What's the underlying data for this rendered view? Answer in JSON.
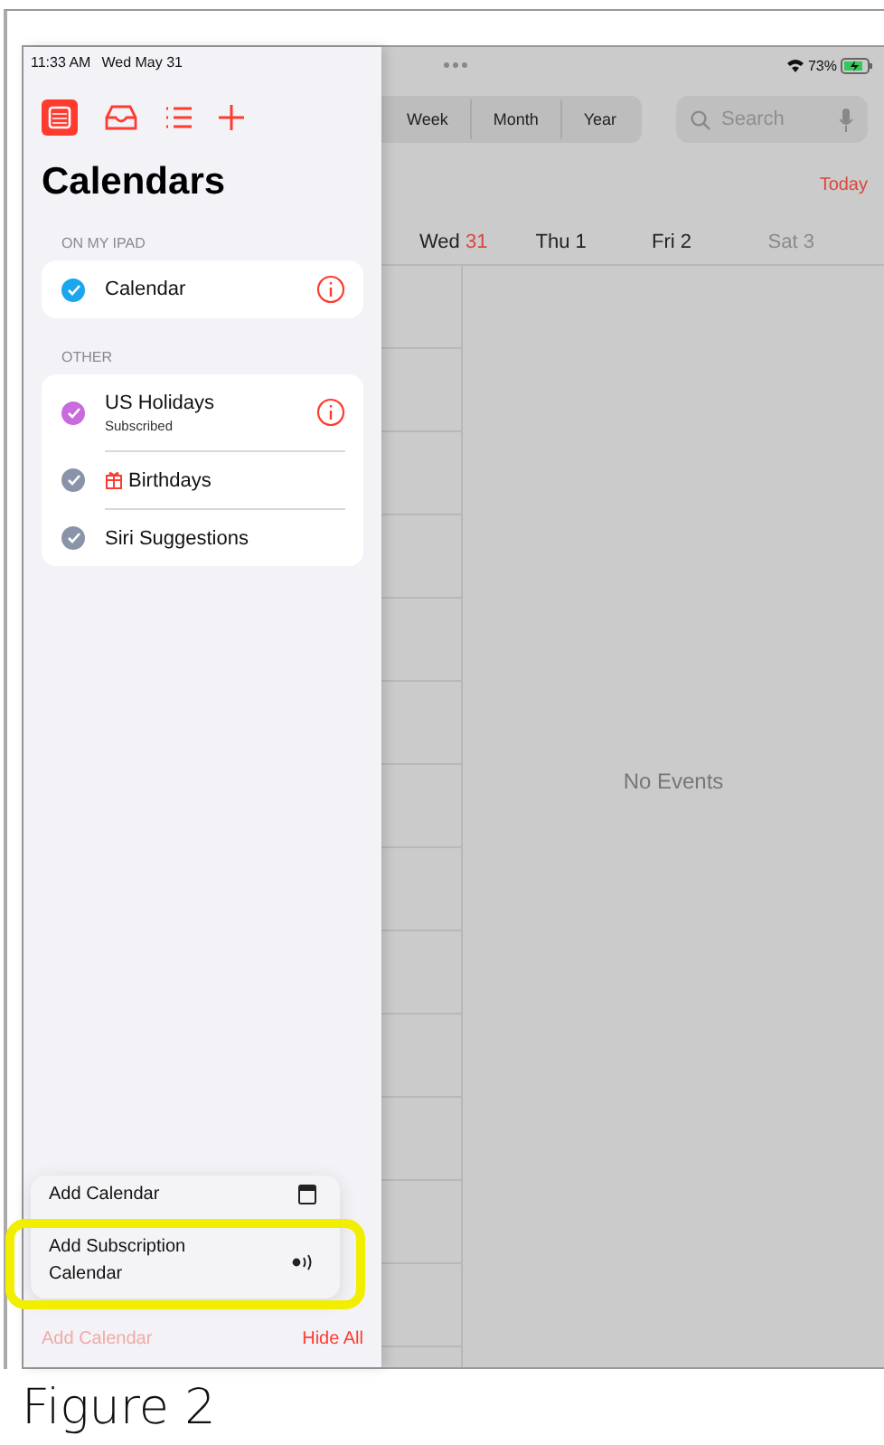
{
  "status_bar": {
    "time": "11:33 AM",
    "date": "Wed May 31",
    "battery": "73%"
  },
  "sidebar": {
    "title": "Calendars",
    "sections": [
      {
        "header": "ON MY IPAD",
        "items": [
          {
            "kind": "plain",
            "name": "Calendar",
            "color": "#1aa7ee",
            "checked": true,
            "info": true
          }
        ]
      },
      {
        "header": "OTHER",
        "items": [
          {
            "kind": "plain",
            "name": "US Holidays",
            "subtitle": "Subscribed",
            "color": "#c86bdc",
            "checked": true,
            "info": true
          },
          {
            "kind": "birthday",
            "name": "Birthdays",
            "color": "#8a94a8",
            "checked": true,
            "info": false
          },
          {
            "kind": "plain",
            "name": "Siri Suggestions",
            "color": "#8a94a8",
            "checked": true,
            "info": false
          }
        ]
      }
    ],
    "menu": [
      {
        "kind": "calendar",
        "label": "Add Calendar",
        "highlighted": false
      },
      {
        "kind": "subscription",
        "label": "Add Subscription Calendar",
        "highlighted": true
      }
    ],
    "footer": {
      "add_calendar": {
        "label": "Add Calendar",
        "disabled": true
      },
      "hide_all": "Hide All"
    }
  },
  "main": {
    "view_tabs": [
      {
        "label": "Week",
        "selected": false
      },
      {
        "label": "Month",
        "selected": false
      },
      {
        "label": "Year",
        "selected": false
      }
    ],
    "search": {
      "placeholder": "Search"
    },
    "today": "Today",
    "days": [
      {
        "weekday": "Wed",
        "date": "31",
        "today": true,
        "dimmed": false
      },
      {
        "weekday": "Thu",
        "date": "1",
        "today": false,
        "dimmed": false
      },
      {
        "weekday": "Fri",
        "date": "2",
        "today": false,
        "dimmed": false
      },
      {
        "weekday": "Sat",
        "date": "3",
        "today": false,
        "dimmed": true
      }
    ],
    "no_events": "No Events"
  },
  "caption": "Figure 2"
}
